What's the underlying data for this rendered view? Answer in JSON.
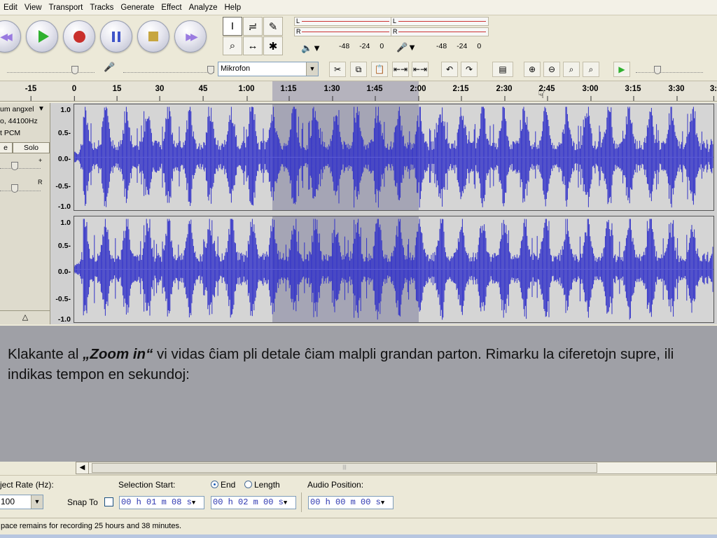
{
  "menu": [
    "Edit",
    "View",
    "Transport",
    "Tracks",
    "Generate",
    "Effect",
    "Analyze",
    "Help"
  ],
  "transport": {
    "buttons": [
      "skip-to-start",
      "play",
      "record",
      "pause",
      "stop",
      "skip-to-end"
    ]
  },
  "tools": {
    "icons": [
      "I",
      "≓",
      "✎",
      "⌕",
      "↔",
      "✱"
    ]
  },
  "meters": {
    "left_channel": "L",
    "right_channel": "R",
    "output_scale": [
      "-48",
      "-24",
      "0"
    ],
    "input_scale": [
      "-48",
      "-24",
      "0"
    ]
  },
  "mixer": {
    "input_source": "Mikrofon"
  },
  "ruler": {
    "labels": [
      "-15",
      "0",
      "15",
      "30",
      "45",
      "1:00",
      "1:15",
      "1:30",
      "1:45",
      "2:00",
      "2:15",
      "2:30",
      "2:45",
      "3:00",
      "3:15",
      "3:30",
      "3:"
    ]
  },
  "track": {
    "name": "um angxel",
    "rate_line": "o, 44100Hz",
    "format_line": "t PCM",
    "mute_label": "e",
    "solo_label": "Solo",
    "pan_right": "R",
    "gain_plus": "+",
    "collapse": "△",
    "scale": [
      "1.0",
      "0.5-",
      "0.0-",
      "-0.5-",
      "-1.0"
    ]
  },
  "slide": {
    "text_before": "Klakante al ",
    "emphasis": "„Zoom in“",
    "text_after": " vi vidas ĉiam pli detale ĉiam malpli grandan parton. Rimarku la ciferetojn supre, ili indikas tempon en sekundoj:"
  },
  "selection_toolbar": {
    "project_rate_label": "ject Rate (Hz):",
    "project_rate_value": "100",
    "snap_to_label": "Snap To",
    "selection_start_label": "Selection Start:",
    "end_label": "End",
    "length_label": "Length",
    "audio_position_label": "Audio Position:",
    "selection_start": "00 h 01 m 08 s",
    "selection_end": "00 h 02 m 00 s",
    "audio_position": "00 h 00 m 00 s"
  },
  "status": {
    "text": "pace remains for recording 25 hours and 38 minutes."
  }
}
